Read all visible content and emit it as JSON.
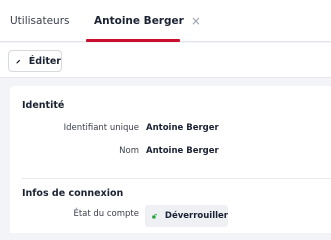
{
  "tabs": {
    "users_label": "Utilisateurs",
    "active_label": "Antoine Berger",
    "close_glyph": "×"
  },
  "toolbar": {
    "edit_label": "Éditer",
    "edit_icon": "pencil-icon"
  },
  "identity": {
    "title": "Identité",
    "rows": [
      {
        "label": "Identifiant unique",
        "value": "Antoine Berger"
      },
      {
        "label": "Nom",
        "value": "Antoine Berger"
      }
    ]
  },
  "connection": {
    "title": "Infos de connexion",
    "account_state_label": "État du compte",
    "unlock_label": "Déverrouiller",
    "unlock_icon": "unlocked-padlock-icon"
  },
  "colors": {
    "accent": "#c8102e",
    "unlock_icon": "#2e9e3f",
    "background": "#f3f4f7"
  }
}
